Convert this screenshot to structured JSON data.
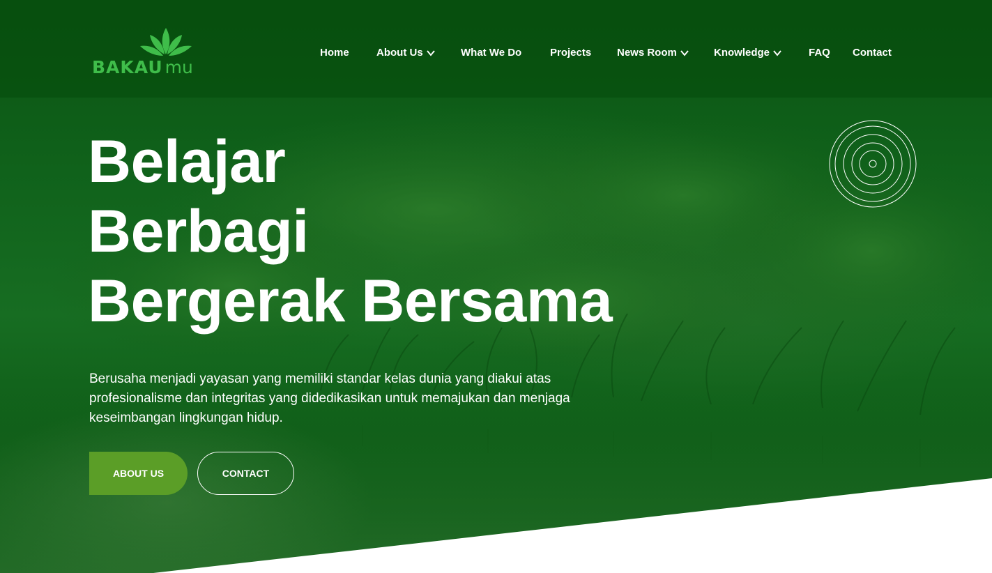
{
  "brand": {
    "logo_text": "BAKAU",
    "logo_suffix": "mu",
    "logo_color": "#3fbd4a"
  },
  "nav": {
    "items": [
      {
        "label": "Home",
        "has_dropdown": false
      },
      {
        "label": "About Us",
        "has_dropdown": true
      },
      {
        "label": "What We Do",
        "has_dropdown": false
      },
      {
        "label": "Projects",
        "has_dropdown": false
      },
      {
        "label": "News Room",
        "has_dropdown": true
      },
      {
        "label": "Knowledge",
        "has_dropdown": true
      },
      {
        "label": "FAQ",
        "has_dropdown": false
      },
      {
        "label": "Contact",
        "has_dropdown": false
      }
    ],
    "dropdown_icon": "chevron-down-icon"
  },
  "hero": {
    "headline_lines": [
      "Belajar",
      "Berbagi",
      "Bergerak Bersama"
    ],
    "subtext": "Berusaha menjadi yayasan yang memiliki standar kelas dunia yang diakui atas profesionalisme dan integritas yang didedikasikan untuk memajukan dan menjaga keseimbangan lingkungan hidup.",
    "buttons": {
      "about": "ABOUT US",
      "contact": "CONTACT"
    },
    "decoration_icon": "concentric-rings-icon",
    "accent_color": "#5b9e27",
    "overlay_color": "#0a5412"
  }
}
